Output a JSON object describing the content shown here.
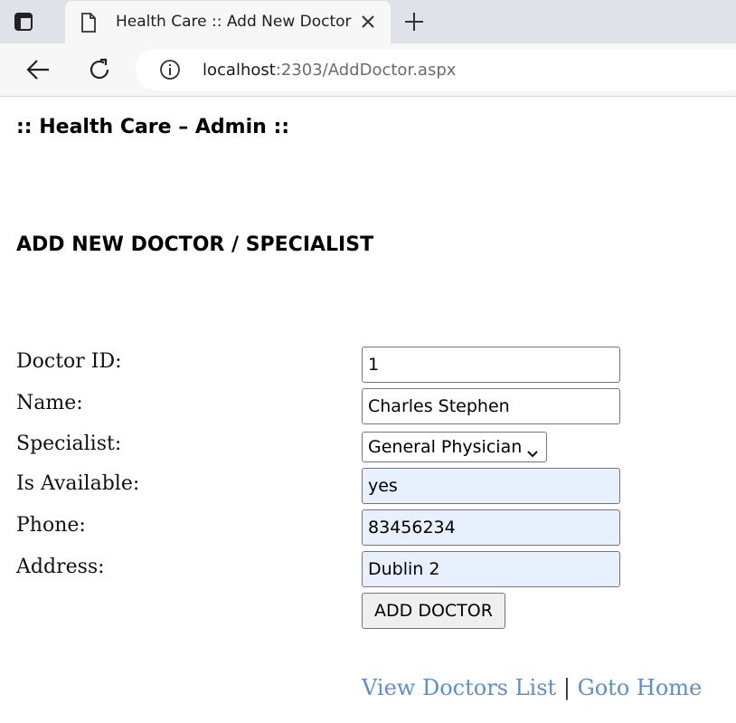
{
  "browser": {
    "tab_title": "Health Care :: Add New Doctor",
    "url_host": "localhost",
    "url_rest": ":2303/AddDoctor.aspx"
  },
  "page": {
    "site_title": ":: Health Care – Admin ::",
    "section_title": "ADD NEW DOCTOR / SPECIALIST"
  },
  "form": {
    "doctor_id_label": "Doctor ID:",
    "doctor_id_value": "1",
    "name_label": "Name:",
    "name_value": "Charles Stephen",
    "specialist_label": "Specialist:",
    "specialist_value": "General Physician",
    "available_label": "Is Available:",
    "available_value": "yes",
    "phone_label": "Phone:",
    "phone_value": "83456234",
    "address_label": "Address:",
    "address_value": "Dublin 2",
    "submit_label": "ADD DOCTOR"
  },
  "links": {
    "view_doctors": "View Doctors List",
    "separator": "|",
    "goto_home": "Goto Home",
    "color": "#5a8fd8"
  },
  "icons": {
    "window": "sidebar-window-icon",
    "tab": "document-icon",
    "close": "close-icon",
    "new_tab": "plus-icon",
    "back": "arrow-left-icon",
    "reload": "reload-icon",
    "info": "info-icon",
    "dropdown": "chevron-down-icon"
  }
}
